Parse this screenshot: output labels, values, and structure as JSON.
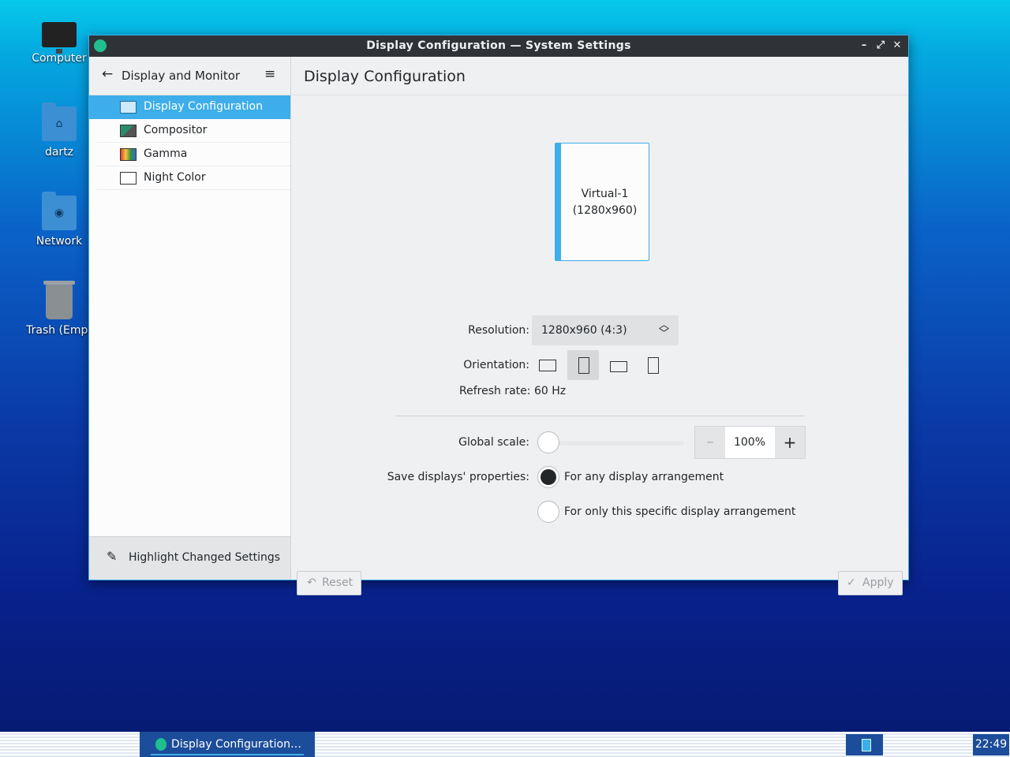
{
  "desktop": {
    "icons": [
      {
        "label": "Computer"
      },
      {
        "label": "dartz"
      },
      {
        "label": "Network"
      },
      {
        "label": "Trash (Empt"
      }
    ]
  },
  "window": {
    "title": "Display Configuration  — System Settings",
    "controls": {
      "minimize": "–",
      "maximize": "⤢",
      "close": "✕"
    }
  },
  "sidebar": {
    "category": "Display and Monitor",
    "back_icon": "←",
    "menu_icon": "≡",
    "items": [
      {
        "label": "Display Configuration",
        "active": true
      },
      {
        "label": "Compositor"
      },
      {
        "label": "Gamma"
      },
      {
        "label": "Night Color"
      }
    ],
    "footer_label": "Highlight Changed Settings"
  },
  "content": {
    "title": "Display Configuration",
    "output": {
      "name": "Virtual-1",
      "resolution_text": "(1280x960)"
    },
    "resolution": {
      "label": "Resolution:",
      "value": "1280x960 (4:3)"
    },
    "orientation": {
      "label": "Orientation:",
      "selected_index": 1
    },
    "refresh_rate": {
      "label": "Refresh rate:",
      "value": "60 Hz"
    },
    "global_scale": {
      "label": "Global scale:",
      "value": "100%",
      "minus": "–",
      "plus": "+"
    },
    "save_properties": {
      "label": "Save displays' properties:",
      "options": [
        {
          "label": "For any display arrangement",
          "checked": true
        },
        {
          "label": "For only this specific display arrangement",
          "checked": false
        }
      ]
    },
    "buttons": {
      "reset": "Reset",
      "apply": "Apply"
    }
  },
  "taskbar": {
    "task_label": "Display Configuration…",
    "clock": "22:49"
  },
  "colors": {
    "accent": "#3daee9",
    "titlebar": "#2f3337",
    "taskbar_item": "#1c4d9a"
  }
}
